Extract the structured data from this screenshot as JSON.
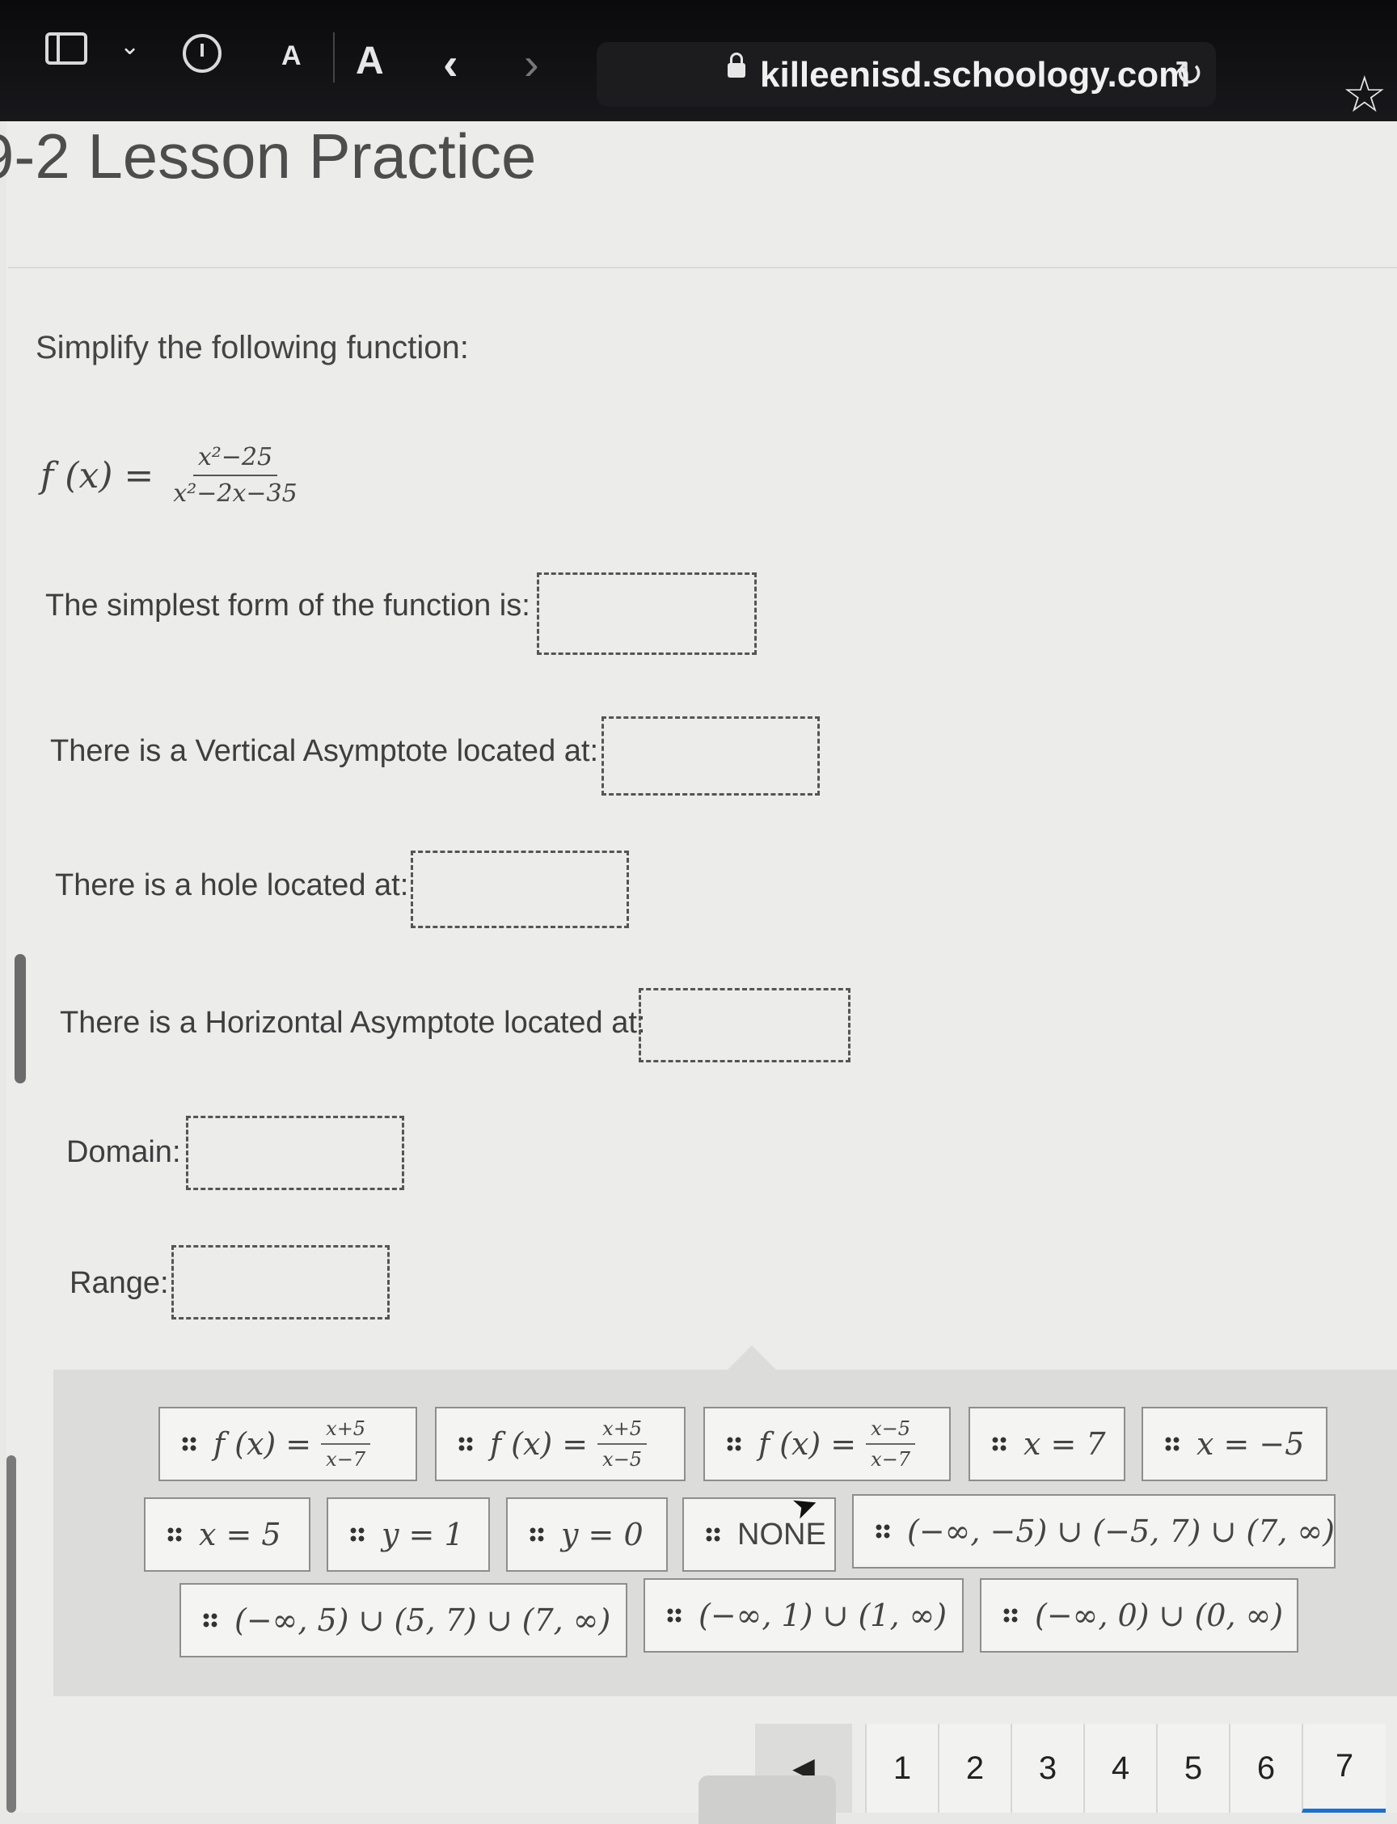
{
  "browser": {
    "url": "killeenisd.schoology.com",
    "font_small": "A",
    "font_large": "A",
    "back": "‹",
    "forward": "›",
    "icons": [
      "sidebar-icon",
      "chevron-down-icon",
      "history-icon",
      "lock-icon",
      "reload-icon",
      "star-icon"
    ]
  },
  "page": {
    "title": "9-2 Lesson Practice",
    "prompt": "Simplify the following function:",
    "function": {
      "lhs": "f (x) =",
      "numerator": "x²−25",
      "denominator": "x²−2x−35"
    },
    "questions": [
      {
        "label": "The simplest form of the function is:"
      },
      {
        "label": "There is a Vertical Asymptote located at:"
      },
      {
        "label": "There is a hole located at:"
      },
      {
        "label": "There is a Horizontal Asymptote located at:"
      },
      {
        "label": "Domain:"
      },
      {
        "label": "Range:"
      }
    ]
  },
  "answer_bank": [
    {
      "lhs": "f (x) =",
      "num": "x+5",
      "den": "x−7"
    },
    {
      "lhs": "f (x) =",
      "num": "x+5",
      "den": "x−5"
    },
    {
      "lhs": "f (x) =",
      "num": "x−5",
      "den": "x−7"
    },
    {
      "text": "x = 7"
    },
    {
      "text": "x = −5"
    },
    {
      "text": "x = 5"
    },
    {
      "text": "y = 1"
    },
    {
      "text": "y = 0"
    },
    {
      "text": "NONE"
    },
    {
      "text": "(−∞, −5) ∪ (−5, 7) ∪ (7, ∞)"
    },
    {
      "text": "(−∞, 5) ∪ (5, 7) ∪ (7, ∞)"
    },
    {
      "text": "(−∞, 1) ∪ (1, ∞)"
    },
    {
      "text": "(−∞, 0) ∪ (0, ∞)"
    }
  ],
  "pagination": {
    "prev": "◀",
    "pages": [
      "1",
      "2",
      "3",
      "4",
      "5",
      "6",
      "7"
    ],
    "current": "7"
  }
}
